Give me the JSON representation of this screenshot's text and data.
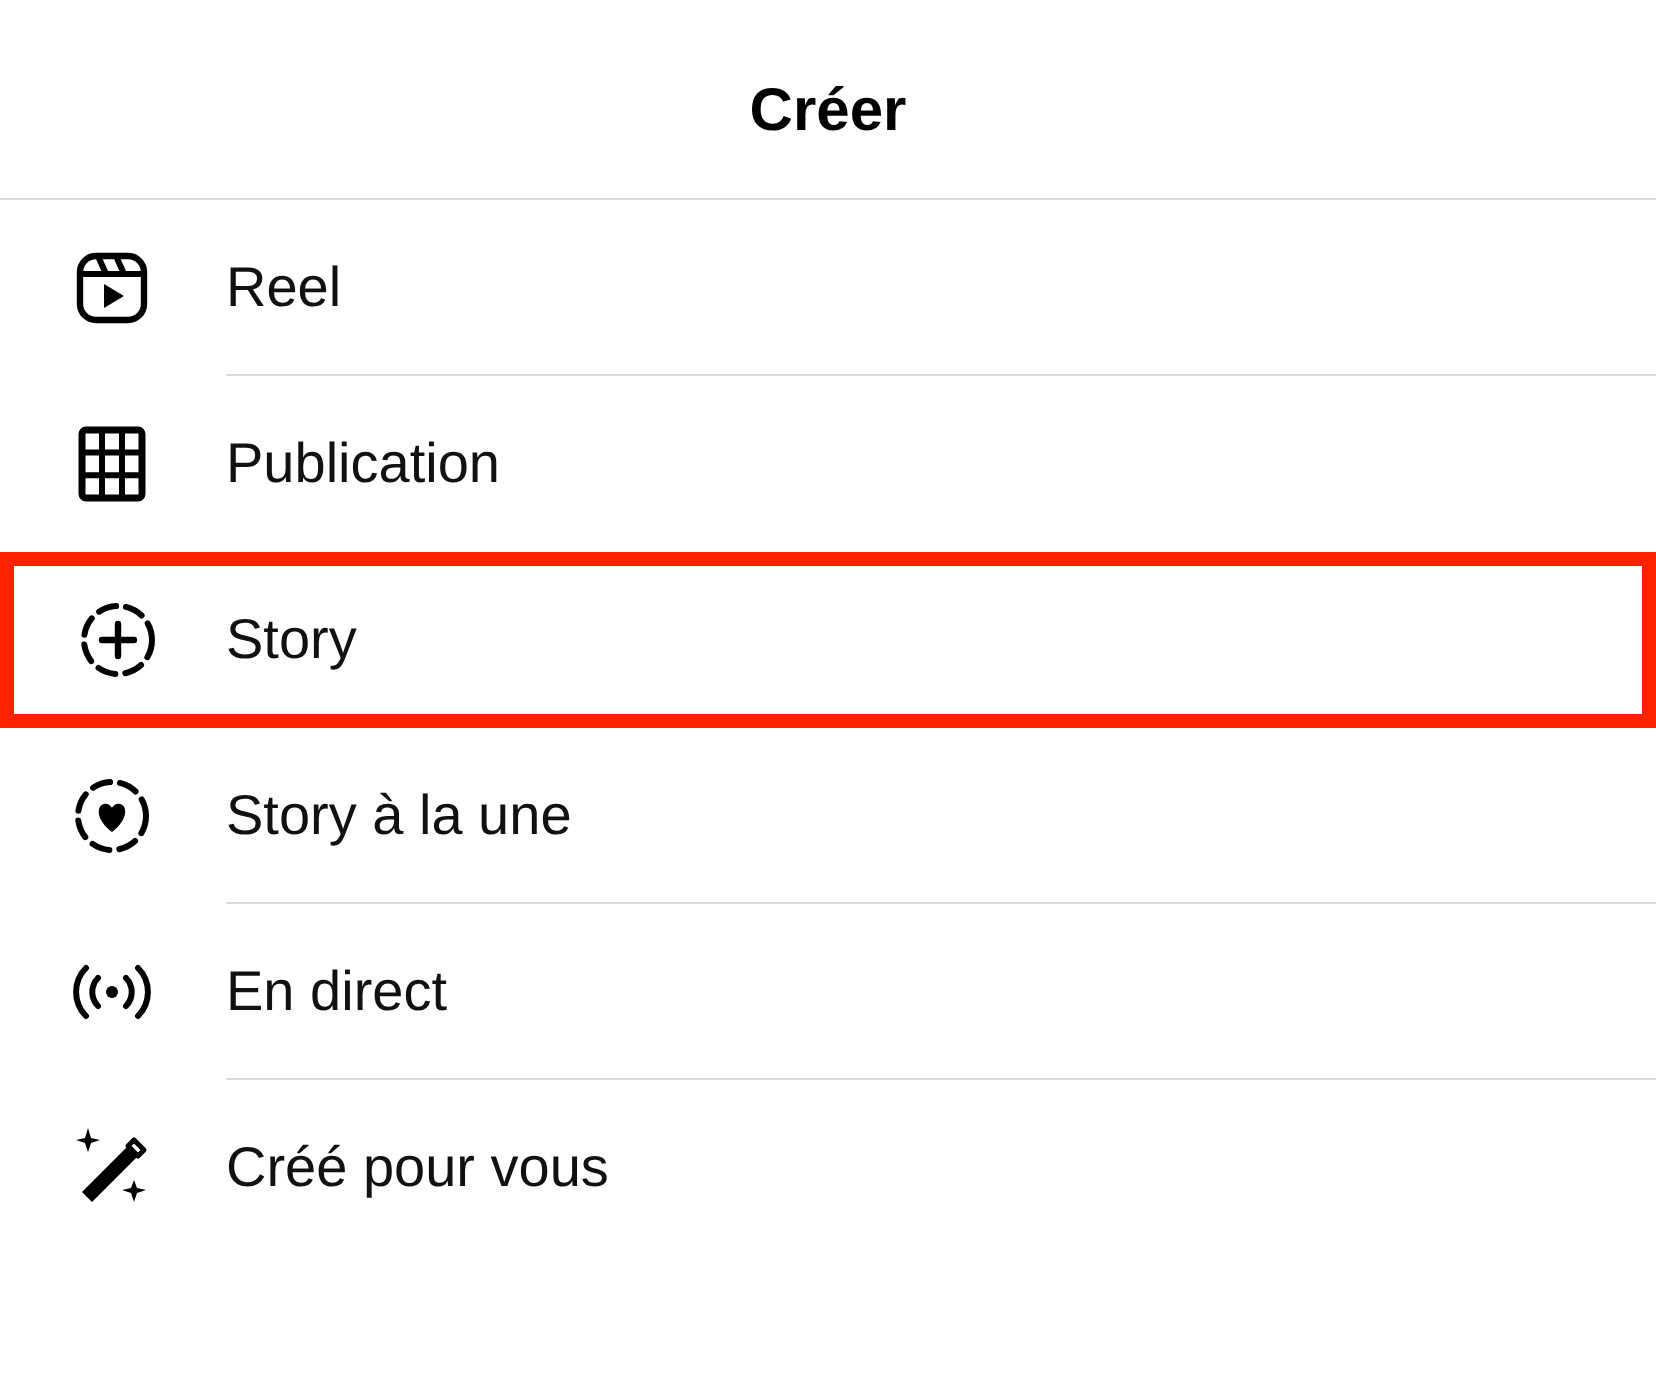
{
  "header": {
    "title": "Créer"
  },
  "items": [
    {
      "kind": "reel",
      "label": "Reel",
      "highlighted": false
    },
    {
      "kind": "grid",
      "label": "Publication",
      "highlighted": false
    },
    {
      "kind": "story-add",
      "label": "Story",
      "highlighted": true
    },
    {
      "kind": "story-heart",
      "label": "Story à la une",
      "highlighted": false
    },
    {
      "kind": "live",
      "label": "En direct",
      "highlighted": false
    },
    {
      "kind": "wand",
      "label": "Créé pour vous",
      "highlighted": false
    }
  ]
}
